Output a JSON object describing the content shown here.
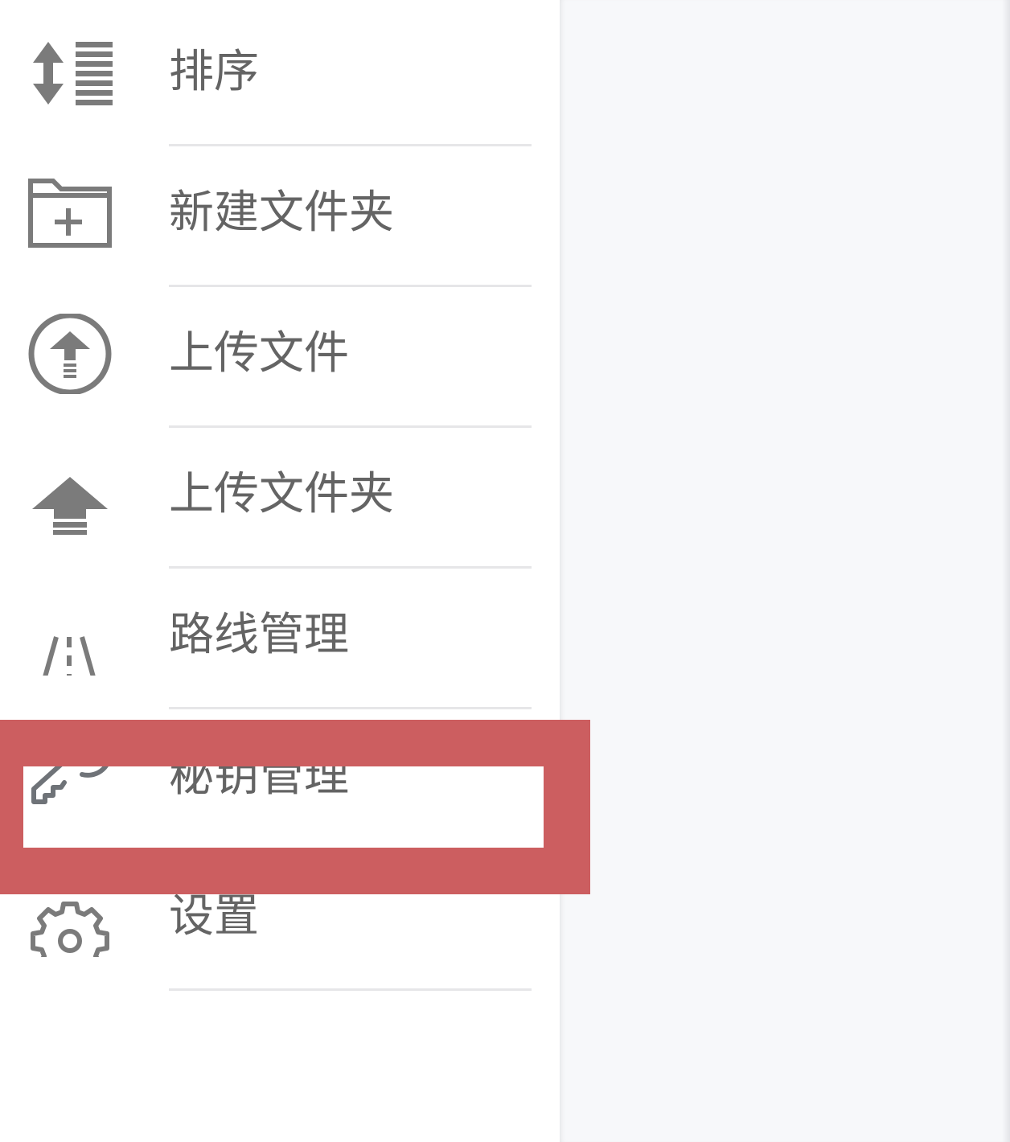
{
  "highlight_color": "#cc5e60",
  "icon_color": "#7b7b7b",
  "menu": {
    "items": [
      {
        "label": "排序",
        "icon": "sort-icon"
      },
      {
        "label": "新建文件夹",
        "icon": "new-folder-icon"
      },
      {
        "label": "上传文件",
        "icon": "upload-file-icon"
      },
      {
        "label": "上传文件夹",
        "icon": "upload-folder-icon"
      },
      {
        "label": "路线管理",
        "icon": "road-icon"
      },
      {
        "label": "秘钥管理",
        "icon": "key-icon",
        "highlighted": true
      },
      {
        "label": "设置",
        "icon": "gear-icon"
      }
    ]
  }
}
